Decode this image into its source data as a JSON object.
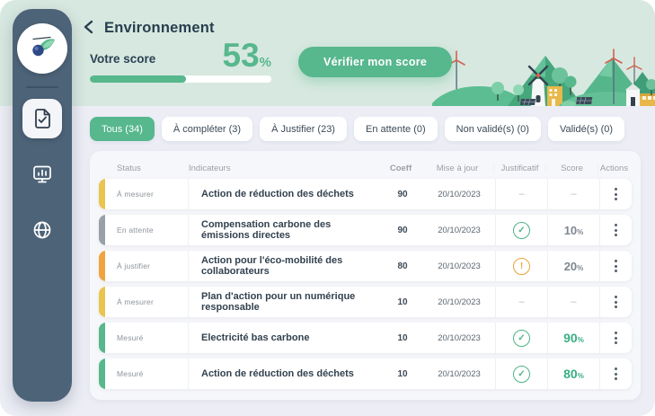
{
  "header": {
    "title": "Environnement",
    "back_icon": "chevron-left-icon"
  },
  "score": {
    "label": "Votre score",
    "value": "53",
    "unit": "%",
    "progress_percent": 53,
    "verify_button_label": "Vérifier mon score"
  },
  "colors": {
    "accent_green": "#57b78d",
    "mint_background": "#d7e8e0",
    "content_background": "#ecedf5",
    "sidebar_background": "#4d6378",
    "status_measure": "#e9c44f",
    "status_waiting": "#98a0a8",
    "status_justify": "#f0a43f",
    "status_measured": "#57b78d",
    "check_green": "#4db386",
    "warn_orange": "#e9a23b"
  },
  "sidebar": {
    "logo_icon": "comet-logo-icon",
    "nav": [
      {
        "icon": "document-check-icon",
        "active": true
      },
      {
        "icon": "monitor-chart-icon",
        "active": false
      },
      {
        "icon": "globe-icon",
        "active": false
      }
    ]
  },
  "tabs": [
    {
      "label": "Tous (34)",
      "active": true
    },
    {
      "label": "À compléter (3)",
      "active": false
    },
    {
      "label": "À Justifier (23)",
      "active": false
    },
    {
      "label": "En attente (0)",
      "active": false
    },
    {
      "label": "Non validé(s) (0)",
      "active": false
    },
    {
      "label": "Validé(s) (0)",
      "active": false
    }
  ],
  "table": {
    "columns": [
      "Status",
      "Indicateurs",
      "Coeff",
      "Mise à jour",
      "Justificatif",
      "Score",
      "Actions"
    ],
    "rows": [
      {
        "status": "À mesurer",
        "accent": "#e9c44f",
        "indicator": "Action de réduction des déchets",
        "coeff": "90",
        "updated": "20/10/2023",
        "justificatif": "none",
        "score": "",
        "score_state": "none"
      },
      {
        "status": "En attente",
        "accent": "#98a0a8",
        "indicator": "Compensation carbone des émissions directes",
        "coeff": "90",
        "updated": "20/10/2023",
        "justificatif": "check",
        "score": "10",
        "score_state": "muted"
      },
      {
        "status": "À justifier",
        "accent": "#f0a43f",
        "indicator": "Action pour l'éco-mobilité des collaborateurs",
        "coeff": "80",
        "updated": "20/10/2023",
        "justificatif": "warn",
        "score": "20",
        "score_state": "muted"
      },
      {
        "status": "À mesurer",
        "accent": "#e9c44f",
        "indicator": "Plan d'action pour un numérique responsable",
        "coeff": "10",
        "updated": "20/10/2023",
        "justificatif": "none",
        "score": "",
        "score_state": "none"
      },
      {
        "status": "Mesuré",
        "accent": "#57b78d",
        "indicator": "Electricité bas carbone",
        "coeff": "10",
        "updated": "20/10/2023",
        "justificatif": "check",
        "score": "90",
        "score_state": "good"
      },
      {
        "status": "Mesuré",
        "accent": "#57b78d",
        "indicator": "Action de réduction des déchets",
        "coeff": "10",
        "updated": "20/10/2023",
        "justificatif": "check",
        "score": "80",
        "score_state": "good"
      }
    ],
    "empty_placeholder": "–",
    "score_suffix": "%"
  }
}
